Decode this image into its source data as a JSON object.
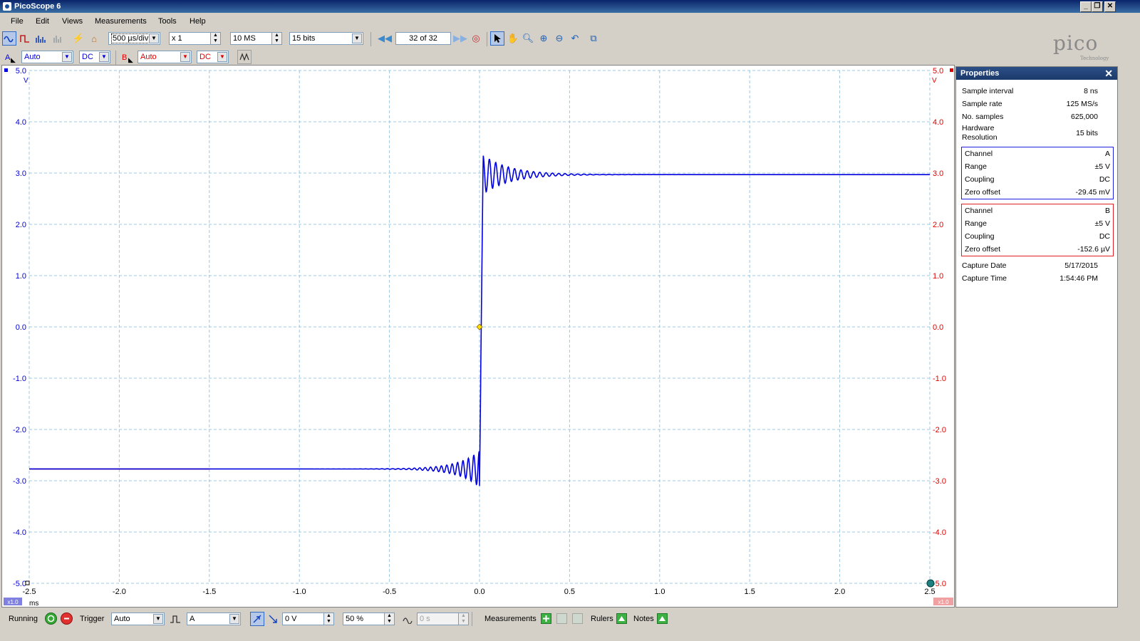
{
  "window": {
    "title": "PicoScope 6"
  },
  "menu": [
    "File",
    "Edit",
    "Views",
    "Measurements",
    "Tools",
    "Help"
  ],
  "toolbar": {
    "timebase": "500 µs/div",
    "zoom": "x 1",
    "samples": "10 MS",
    "resolution": "15 bits",
    "buffer": "32 of 32"
  },
  "channel_bar": {
    "a_label": "A",
    "a_range": "Auto",
    "a_coupling": "DC",
    "b_label": "B",
    "b_range": "Auto",
    "b_coupling": "DC"
  },
  "logo": {
    "text": "pico",
    "sub": "Technology"
  },
  "properties": {
    "title": "Properties",
    "general": [
      {
        "k": "Sample interval",
        "v": "8 ns"
      },
      {
        "k": "Sample rate",
        "v": "125 MS/s"
      },
      {
        "k": "No. samples",
        "v": "625,000"
      },
      {
        "k": "Hardware",
        "v": "15 bits",
        "k2": "Resolution"
      }
    ],
    "channel_a": [
      {
        "k": "Channel",
        "v": "A"
      },
      {
        "k": "Range",
        "v": "±5 V"
      },
      {
        "k": "Coupling",
        "v": "DC"
      },
      {
        "k": "Zero offset",
        "v": "-29.45 mV"
      }
    ],
    "channel_b": [
      {
        "k": "Channel",
        "v": "B"
      },
      {
        "k": "Range",
        "v": "±5 V"
      },
      {
        "k": "Coupling",
        "v": "DC"
      },
      {
        "k": "Zero offset",
        "v": "-152.6 µV"
      }
    ],
    "capture": [
      {
        "k": "Capture Date",
        "v": "5/17/2015"
      },
      {
        "k": "Capture Time",
        "v": "1:54:46 PM"
      }
    ]
  },
  "status": {
    "running": "Running",
    "trigger": "Trigger",
    "trigger_mode": "Auto",
    "trigger_source": "A",
    "trigger_level": "0 V",
    "pretrigger": "50 %",
    "delay": "0 s",
    "measurements": "Measurements",
    "rulers": "Rulers",
    "notes": "Notes"
  },
  "colors": {
    "channel_a": "#0000e0",
    "channel_b": "#e00000",
    "grid": "#9cc8e0"
  },
  "chart_data": {
    "type": "line",
    "xlabel": "ms",
    "xlim": [
      -2.5,
      2.5
    ],
    "ylim": [
      -5.0,
      5.0
    ],
    "x_ticks": [
      "-2.5",
      "-2.0",
      "-1.5",
      "-1.0",
      "-0.5",
      "0.0",
      "0.5",
      "1.0",
      "1.5",
      "2.0",
      "2.5"
    ],
    "y_ticks_left": [
      "5.0",
      "4.0",
      "3.0",
      "2.0",
      "1.0",
      "0.0",
      "-1.0",
      "-2.0",
      "-3.0",
      "-4.0",
      "-5.0"
    ],
    "y_ticks_right": [
      "5.0",
      "4.0",
      "3.0",
      "2.0",
      "1.0",
      "0.0",
      "-1.0",
      "-2.0",
      "-3.0",
      "-4.0",
      "-5.0"
    ],
    "y_unit_left": "V",
    "y_unit_right": "V",
    "scale_left": "x1.0",
    "scale_right": "x1.0",
    "grid": true,
    "series": [
      {
        "name": "A",
        "color": "#0000e0",
        "x": [
          -2.5,
          -1.0,
          -0.5,
          -0.25,
          -0.1,
          -0.02,
          0.0,
          0.02,
          0.03,
          0.1,
          0.25,
          0.5,
          1.0,
          2.5
        ],
        "y": [
          -2.77,
          -2.77,
          -2.77,
          -2.77,
          -2.7,
          -3.1,
          0.0,
          3.3,
          3.35,
          3.05,
          3.0,
          2.98,
          2.97,
          2.97
        ]
      },
      {
        "name": "B",
        "color": "#e00000",
        "x": [
          -2.5,
          -1.5
        ],
        "y": [
          -2.77,
          -2.77
        ]
      }
    ],
    "trigger_marker": {
      "x": 0.0,
      "y": 0.0
    }
  }
}
